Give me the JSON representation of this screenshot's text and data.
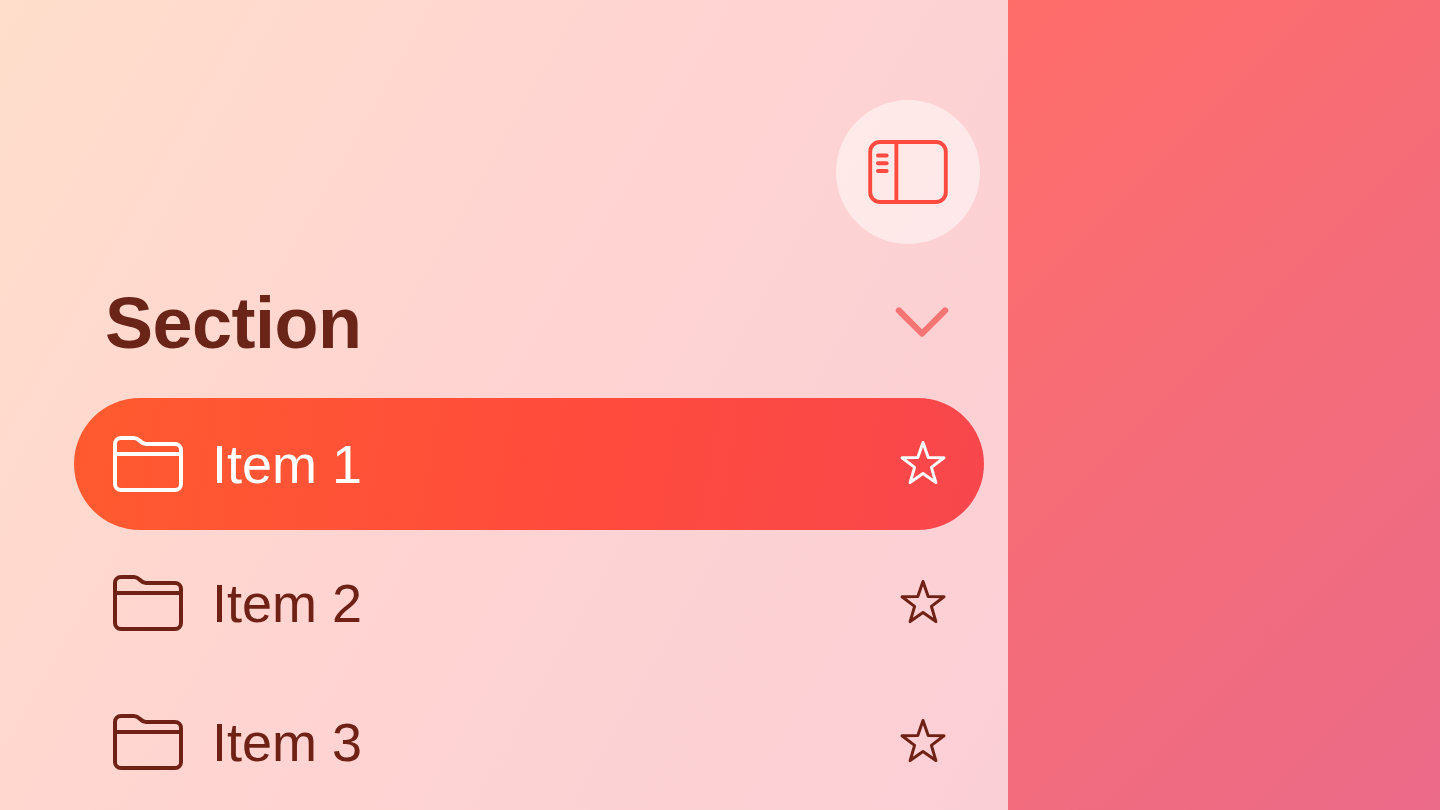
{
  "sidebar": {
    "section": {
      "title": "Section",
      "expanded": true
    },
    "items": [
      {
        "label": "Item 1",
        "selected": true
      },
      {
        "label": "Item 2",
        "selected": false
      },
      {
        "label": "Item 3",
        "selected": false
      }
    ]
  }
}
